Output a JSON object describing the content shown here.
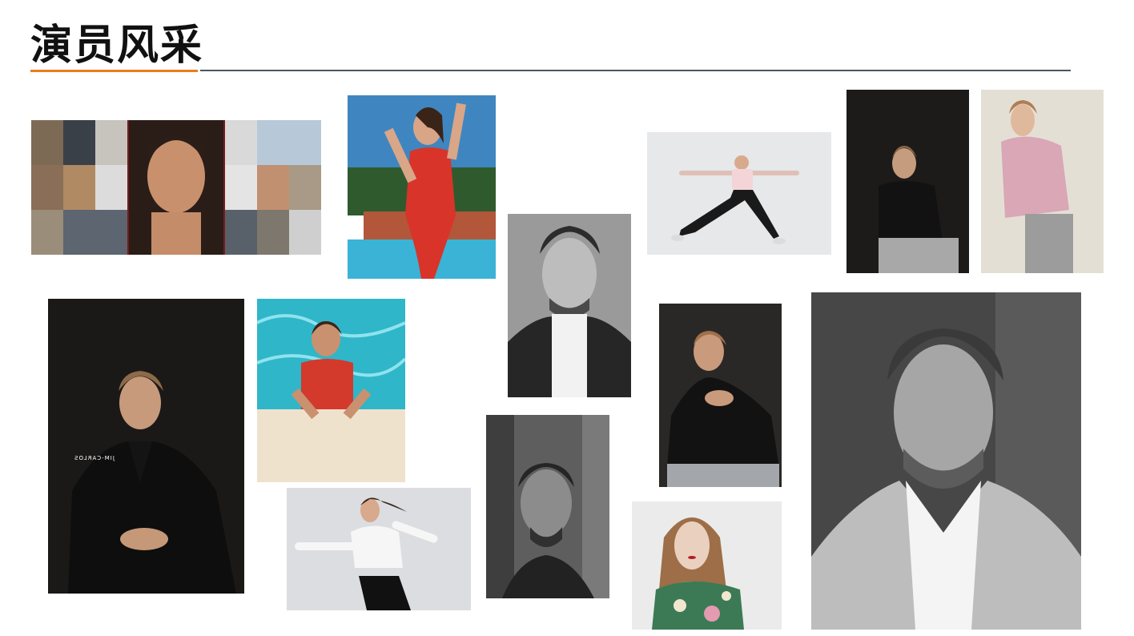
{
  "page": {
    "title": "演员风采"
  },
  "photos": [
    {
      "name": "collage-male-model",
      "caption": ""
    },
    {
      "name": "woman-red-swimsuit-poolside",
      "caption": ""
    },
    {
      "name": "man-turtleneck-bw",
      "caption": ""
    },
    {
      "name": "woman-yoga-pose",
      "caption": ""
    },
    {
      "name": "man-seated-dark",
      "caption": ""
    },
    {
      "name": "woman-pink-blouse",
      "caption": ""
    },
    {
      "name": "man-black-suit",
      "caption": "JIM-CARLOS"
    },
    {
      "name": "woman-in-pool",
      "caption": ""
    },
    {
      "name": "woman-white-crop-top-dance",
      "caption": ""
    },
    {
      "name": "man-reflection-bw",
      "caption": ""
    },
    {
      "name": "man-black-shirt-watch",
      "caption": ""
    },
    {
      "name": "woman-floral-top",
      "caption": ""
    },
    {
      "name": "man-blazer-bw-portrait",
      "caption": ""
    }
  ]
}
